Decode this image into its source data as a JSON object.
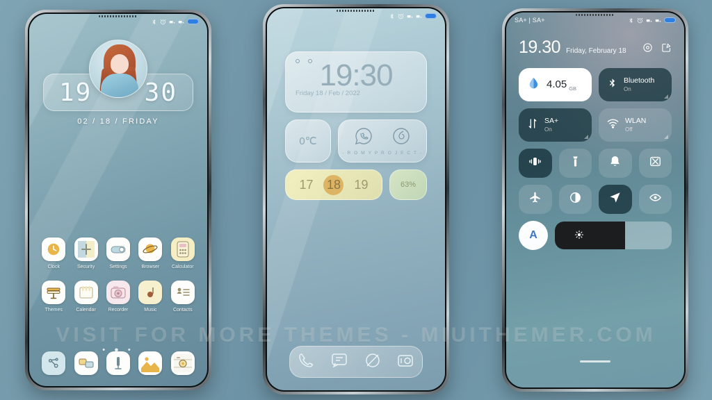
{
  "watermark": "VISIT FOR MORE THEMES - MIUITHEMER.COM",
  "phone1": {
    "statusbar": {
      "icons": [
        "bluetooth-icon",
        "alarm-icon",
        "signal-icon",
        "signal-icon",
        "battery-icon"
      ]
    },
    "clock": {
      "hours": "19",
      "minutes": "30",
      "date": "02 / 18 / FRIDAY"
    },
    "apps": [
      {
        "label": "Clock",
        "icon": "clock-icon"
      },
      {
        "label": "Security",
        "icon": "shield-icon"
      },
      {
        "label": "Settings",
        "icon": "toggle-icon"
      },
      {
        "label": "Browser",
        "icon": "planet-icon"
      },
      {
        "label": "Calculator",
        "icon": "calculator-icon"
      },
      {
        "label": "Themes",
        "icon": "brush-icon"
      },
      {
        "label": "Calendar",
        "icon": "calendar-icon"
      },
      {
        "label": "Recorder",
        "icon": "recorder-icon"
      },
      {
        "label": "Music",
        "icon": "music-note-icon"
      },
      {
        "label": "Contacts",
        "icon": "contacts-icon"
      }
    ],
    "page_dots": "• ● •",
    "dock": [
      {
        "label": "ShareMe",
        "icon": "share-network-icon"
      },
      {
        "label": "Messages",
        "icon": "messages-icon"
      },
      {
        "label": "Recorder",
        "icon": "microphone-icon"
      },
      {
        "label": "Gallery",
        "icon": "gallery-icon"
      },
      {
        "label": "Camera",
        "icon": "camera-icon"
      }
    ]
  },
  "phone2": {
    "clock": {
      "time": "19:30",
      "date": "Friday 18 / Feb / 2022"
    },
    "weather": {
      "temperature": "0℃"
    },
    "project": {
      "label": "- R O M Y   P R O J E C T -",
      "icons": [
        "whatsapp-icon",
        "spiral-icon"
      ]
    },
    "calendar": {
      "days": [
        "17",
        "18",
        "19"
      ],
      "selected": "18"
    },
    "battery": {
      "percent": "63%"
    },
    "dock": [
      {
        "label": "Phone",
        "icon": "phone-icon"
      },
      {
        "label": "Messages",
        "icon": "message-bubble-icon"
      },
      {
        "label": "Browser",
        "icon": "planet-icon"
      },
      {
        "label": "Camera",
        "icon": "camera-icon"
      }
    ]
  },
  "phone3": {
    "statusbar": {
      "carrier": "SA+ | SA+"
    },
    "header": {
      "time": "19.30",
      "date": "Friday, February 18"
    },
    "big_tiles": [
      {
        "title": "4.05",
        "unit": "GB",
        "sub": "",
        "icon": "data-drop-icon",
        "state": "white"
      },
      {
        "title": "Bluetooth",
        "unit": "",
        "sub": "On",
        "icon": "bluetooth-icon",
        "state": "dark"
      },
      {
        "title": "SA+",
        "unit": "",
        "sub": "On",
        "icon": "data-arrows-icon",
        "state": "dark"
      },
      {
        "title": "WLAN",
        "unit": "",
        "sub": "Off",
        "icon": "wifi-icon",
        "state": "off"
      }
    ],
    "small_tiles": [
      {
        "icon": "vibrate-icon",
        "state": "on"
      },
      {
        "icon": "flashlight-icon",
        "state": "off"
      },
      {
        "icon": "bell-icon",
        "state": "off"
      },
      {
        "icon": "screenshot-icon",
        "state": "off"
      },
      {
        "icon": "airplane-icon",
        "state": "off"
      },
      {
        "icon": "dark-mode-icon",
        "state": "off"
      },
      {
        "icon": "location-icon",
        "state": "on"
      },
      {
        "icon": "eye-icon",
        "state": "off"
      }
    ],
    "brightness": {
      "auto_label": "A",
      "level_percent": 60,
      "icon": "sun-icon"
    }
  }
}
